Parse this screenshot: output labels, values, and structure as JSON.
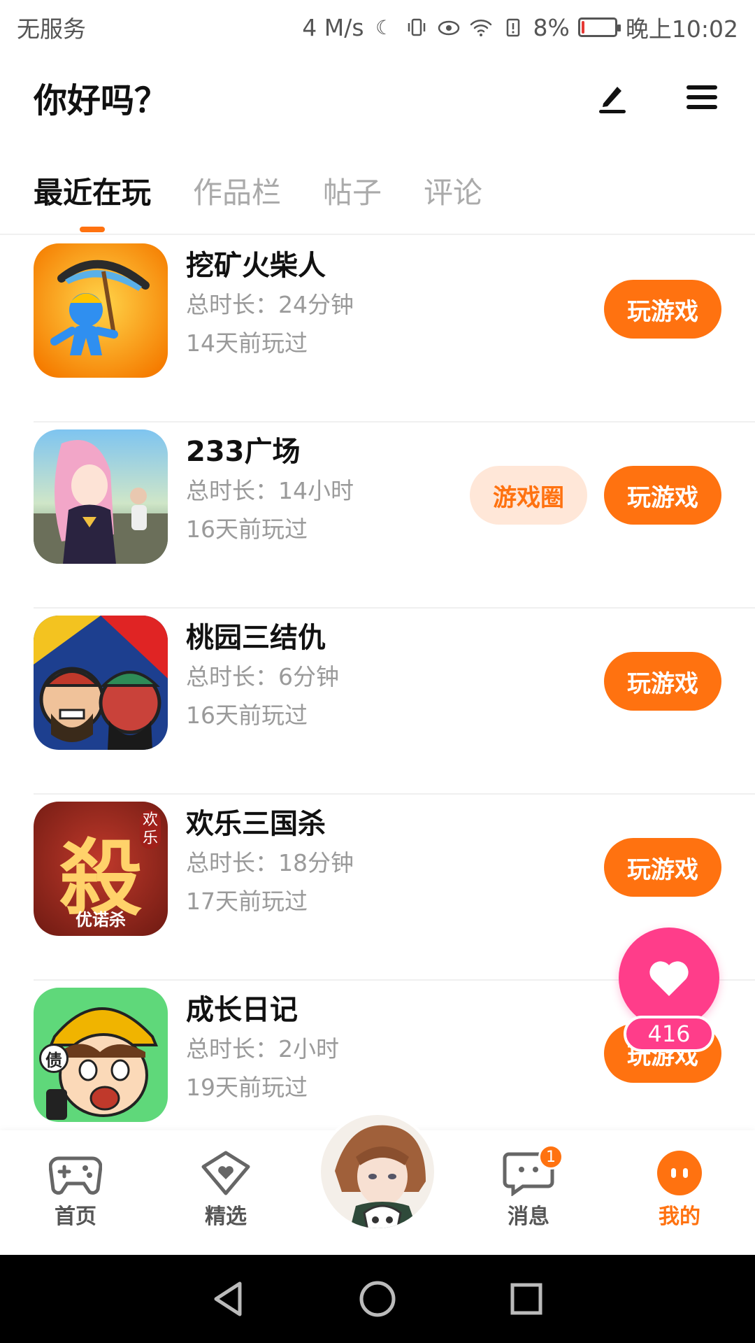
{
  "status_bar": {
    "carrier": "无服务",
    "net_speed": "4 M/s",
    "battery_pct": "8%",
    "battery_level": 0.08,
    "time": "晚上10:02"
  },
  "header": {
    "title": "你好吗？",
    "edit_icon": "edit-icon",
    "menu_icon": "menu-icon"
  },
  "tabs": [
    {
      "label": "最近在玩",
      "active": true
    },
    {
      "label": "作品栏",
      "active": false
    },
    {
      "label": "帖子",
      "active": false
    },
    {
      "label": "评论",
      "active": false
    }
  ],
  "games": [
    {
      "name": "挖矿火柴人",
      "duration": "总时长：24分钟",
      "last_played": "14天前玩过",
      "play_label": "玩游戏"
    },
    {
      "name": "233广场",
      "duration": "总时长：14小时",
      "last_played": "16天前玩过",
      "play_label": "玩游戏",
      "circle_label": "游戏圈"
    },
    {
      "name": "桃园三结仇",
      "duration": "总时长：6分钟",
      "last_played": "16天前玩过",
      "play_label": "玩游戏"
    },
    {
      "name": "欢乐三国杀",
      "duration": "总时长：18分钟",
      "last_played": "17天前玩过",
      "play_label": "玩游戏",
      "thumb_text": "殺",
      "thumb_tag": "欢乐",
      "thumb_sub": "优诺杀"
    },
    {
      "name": "成长日记",
      "duration": "总时长：2小时",
      "last_played": "19天前玩过",
      "play_label": "玩游戏",
      "thumb_text": "债"
    }
  ],
  "fab": {
    "count": "416",
    "icon": "heart-icon"
  },
  "bottom_nav": [
    {
      "label": "首页",
      "icon": "gamepad-icon"
    },
    {
      "label": "精选",
      "icon": "heart-chat-icon"
    },
    {
      "label": "消息",
      "icon": "message-icon",
      "badge": "1"
    },
    {
      "label": "我的",
      "icon": "profile-face-icon",
      "active": true
    }
  ],
  "colors": {
    "accent": "#ff7210",
    "fab": "#ff3d8a",
    "circle_bg": "#ffe7d8"
  }
}
